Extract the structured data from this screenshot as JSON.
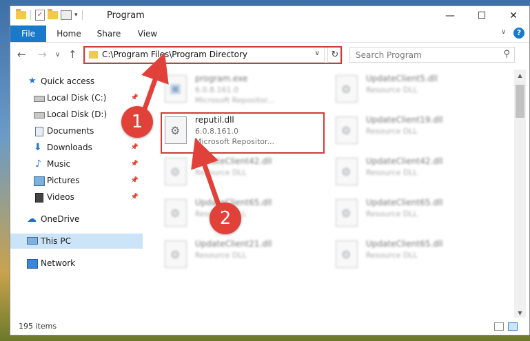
{
  "window": {
    "title": "Program",
    "minimize": "—",
    "maximize": "☐",
    "close": "✕"
  },
  "ribbon": {
    "tabs": [
      "File",
      "Home",
      "Share",
      "View"
    ],
    "help": "?",
    "expand": "∨"
  },
  "address": {
    "path": "C:\\Program Files\\Program Directory",
    "caret": "∨",
    "refresh": "↻",
    "back": "←",
    "forward": "→",
    "recent": "∨",
    "up": "↑"
  },
  "search": {
    "placeholder": "Search Program",
    "icon": "search-icon"
  },
  "sidebar": {
    "items": [
      {
        "label": "Quick access",
        "icon": "star-icon"
      },
      {
        "label": "Local Disk (C:)",
        "icon": "disk-icon"
      },
      {
        "label": "Local Disk (D:)",
        "icon": "disk-icon"
      },
      {
        "label": "Documents",
        "icon": "documents-icon"
      },
      {
        "label": "Downloads",
        "icon": "downloads-icon"
      },
      {
        "label": "Music",
        "icon": "music-icon"
      },
      {
        "label": "Pictures",
        "icon": "pictures-icon"
      },
      {
        "label": "Videos",
        "icon": "videos-icon"
      },
      {
        "label": "OneDrive",
        "icon": "cloud-icon"
      },
      {
        "label": "This PC",
        "icon": "pc-icon"
      },
      {
        "label": "Network",
        "icon": "network-icon"
      }
    ],
    "pin": "📌"
  },
  "files": [
    {
      "name": "program.exe",
      "line2": "6.0.8.161.0",
      "line3": "Microsoft Repositor..."
    },
    {
      "name": "UpdateClient5.dll",
      "line2": "Resource DLL",
      "line3": ""
    },
    {
      "name": "reputil.dll",
      "line2": "6.0.8.161.0",
      "line3": "Microsoft Repositor..."
    },
    {
      "name": "UpdateClient19.dll",
      "line2": "Resource DLL",
      "line3": ""
    },
    {
      "name": "UpdateClient42.dll",
      "line2": "Resource DLL",
      "line3": ""
    },
    {
      "name": "UpdateClient42.dll",
      "line2": "Resource DLL",
      "line3": ""
    },
    {
      "name": "UpdateClient65.dll",
      "line2": "Resource DLL",
      "line3": ""
    },
    {
      "name": "UpdateClient65.dll",
      "line2": "Resource DLL",
      "line3": ""
    },
    {
      "name": "UpdateClient21.dll",
      "line2": "Resource DLL",
      "line3": ""
    },
    {
      "name": "UpdateClient65.dll",
      "line2": "Resource DLL",
      "line3": ""
    }
  ],
  "status": {
    "count": "195 items"
  },
  "annotations": {
    "step1": "1",
    "step2": "2",
    "color": "#e2413a"
  },
  "colors": {
    "accent": "#1979ca",
    "highlight": "#d13a3a",
    "selected": "#cce4f7"
  }
}
